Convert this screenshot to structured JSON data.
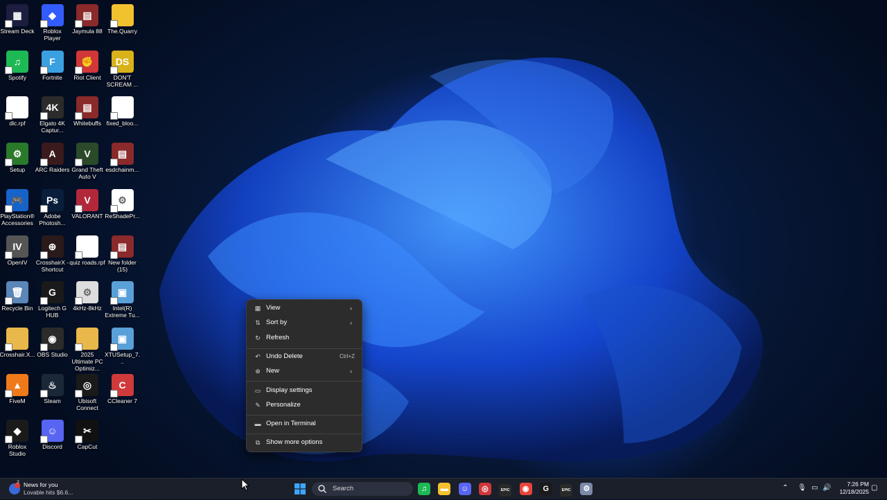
{
  "desktop": {
    "icons": [
      {
        "label": "Stream Deck",
        "color": "#1d1d3f",
        "glyph": "▦"
      },
      {
        "label": "Spotify",
        "color": "#1db954",
        "glyph": "♫"
      },
      {
        "label": "dlc.rpf",
        "color": "#ffffff",
        "glyph": ""
      },
      {
        "label": "Setup",
        "color": "#2a7a2a",
        "glyph": "⚙"
      },
      {
        "label": "PlayStation® Accessories",
        "color": "#1663c9",
        "glyph": "🎮"
      },
      {
        "label": "OpenIV",
        "color": "#555555",
        "glyph": "IV"
      },
      {
        "label": "Recycle Bin",
        "color": "#5a86b8",
        "glyph": "🗑"
      },
      {
        "label": "Crosshair.X...",
        "color": "#e8b84a",
        "glyph": ""
      },
      {
        "label": "FiveM",
        "color": "#f07a1a",
        "glyph": "▲"
      },
      {
        "label": "Roblox Studio",
        "color": "#1a1a1a",
        "glyph": "◆"
      },
      {
        "label": "Roblox Player",
        "color": "#335cff",
        "glyph": "◆"
      },
      {
        "label": "Fortnite",
        "color": "#3aa0e0",
        "glyph": "F"
      },
      {
        "label": "Elgato 4K Captur...",
        "color": "#2b2b2b",
        "glyph": "4K"
      },
      {
        "label": "ARC Raiders",
        "color": "#3a1a1a",
        "glyph": "A"
      },
      {
        "label": "Adobe Photosh...",
        "color": "#0a1e3c",
        "glyph": "Ps"
      },
      {
        "label": "CrosshairX - Shortcut",
        "color": "#2a1a1a",
        "glyph": "⊕"
      },
      {
        "label": "Logitech G HUB",
        "color": "#1a1a1a",
        "glyph": "G"
      },
      {
        "label": "OBS Studio",
        "color": "#2b2b2b",
        "glyph": "◉"
      },
      {
        "label": "Steam",
        "color": "#1b2838",
        "glyph": "♨"
      },
      {
        "label": "Discord",
        "color": "#5865f2",
        "glyph": "☺"
      },
      {
        "label": "Jaymula 88",
        "color": "#8a2a2a",
        "glyph": "▤"
      },
      {
        "label": "Riot Client",
        "color": "#d13639",
        "glyph": "✊"
      },
      {
        "label": "Whitebuffs",
        "color": "#8a2a2a",
        "glyph": "▤"
      },
      {
        "label": "Grand Theft Auto V",
        "color": "#2a4a2a",
        "glyph": "V"
      },
      {
        "label": "VALORANT",
        "color": "#b2283a",
        "glyph": "V"
      },
      {
        "label": "quiz roads.rpf",
        "color": "#ffffff",
        "glyph": ""
      },
      {
        "label": "4kHz-8kHz",
        "color": "#dddddd",
        "glyph": "⚙"
      },
      {
        "label": "2025 Ultimate PC Optimiz...",
        "color": "#e8b84a",
        "glyph": ""
      },
      {
        "label": "Ubisoft Connect",
        "color": "#1a1a1a",
        "glyph": "◎"
      },
      {
        "label": "CapCut",
        "color": "#111111",
        "glyph": "✂"
      },
      {
        "label": "The.Quarry",
        "color": "#f2c12e",
        "glyph": ""
      },
      {
        "label": "DON'T SCREAM ...",
        "color": "#d9b21a",
        "glyph": "DS"
      },
      {
        "label": "fixed_bloo...",
        "color": "#ffffff",
        "glyph": ""
      },
      {
        "label": "esdchainm...",
        "color": "#8a2a2a",
        "glyph": "▤"
      },
      {
        "label": "ReShadePr...",
        "color": "#ffffff",
        "glyph": "⚙"
      },
      {
        "label": "New folder (15)",
        "color": "#8a2a2a",
        "glyph": "▤"
      },
      {
        "label": "Intel(R) Extreme Tu...",
        "color": "#5aa0d8",
        "glyph": "▣"
      },
      {
        "label": "XTUSetup_7...",
        "color": "#5aa0d8",
        "glyph": "▣"
      },
      {
        "label": "CCleaner 7",
        "color": "#d03a3a",
        "glyph": "C"
      }
    ]
  },
  "context_menu": {
    "view": "View",
    "sort_by": "Sort by",
    "refresh": "Refresh",
    "undo_delete": "Undo Delete",
    "undo_shortcut": "Ctrl+Z",
    "new": "New",
    "display_settings": "Display settings",
    "personalize": "Personalize",
    "open_terminal": "Open in Terminal",
    "show_more": "Show more options"
  },
  "taskbar": {
    "news_title": "News for you",
    "news_subtitle": "Lovable hits $6.6...",
    "news_badge": "2",
    "search_placeholder": "Search",
    "pinned": [
      {
        "name": "spotify",
        "glyph": "♫",
        "color": "#1db954"
      },
      {
        "name": "file-explorer",
        "glyph": "▬",
        "color": "#f2c12e"
      },
      {
        "name": "discord",
        "glyph": "☺",
        "color": "#5865f2"
      },
      {
        "name": "riot",
        "glyph": "◎",
        "color": "#d13639"
      },
      {
        "name": "epic-games",
        "glyph": "EPIC",
        "color": "#2a2a2a"
      },
      {
        "name": "chrome",
        "glyph": "◉",
        "color": "#e8443a"
      },
      {
        "name": "logitech",
        "glyph": "G",
        "color": "#1a1a1a"
      },
      {
        "name": "epic-games-2",
        "glyph": "EPIC",
        "color": "#2a2a2a"
      },
      {
        "name": "settings",
        "glyph": "⚙",
        "color": "#7a8aa8"
      }
    ],
    "time": "7:26 PM",
    "date": "12/18/2025"
  }
}
